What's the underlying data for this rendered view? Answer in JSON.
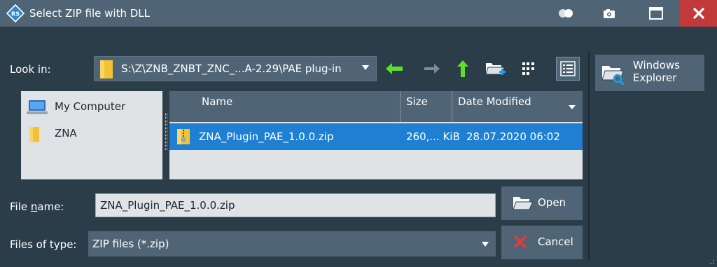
{
  "window": {
    "title": "Select ZIP file with DLL"
  },
  "lookin": {
    "label": "Look in:",
    "path": "S:\\Z\\ZNB_ZNBT_ZNC_...A-2.29\\PAE plug-in"
  },
  "sidebar": {
    "explorer_label": "Windows\nExplorer"
  },
  "places": {
    "items": [
      {
        "label": "My Computer",
        "icon": "computer-icon"
      },
      {
        "label": "ZNA",
        "icon": "folder-icon"
      }
    ]
  },
  "files": {
    "columns": [
      "Name",
      "Size",
      "Date Modified"
    ],
    "rows": [
      {
        "name": "ZNA_Plugin_PAE_1.0.0.zip",
        "size": "260,... KiB",
        "modified": "28.07.2020 06:02",
        "icon": "zip-file-icon",
        "selected": true
      }
    ]
  },
  "filename": {
    "label_pre": "File ",
    "label_u": "n",
    "label_post": "ame:",
    "value": "ZNA_Plugin_PAE_1.0.0.zip"
  },
  "filetype": {
    "label": "Files of type:",
    "value": "ZIP files (*.zip)"
  },
  "buttons": {
    "open": "Open",
    "cancel": "Cancel"
  },
  "colors": {
    "titlebar": "#4f6576",
    "background": "#2c3d4a",
    "selection": "#1e7fd3",
    "close": "#c03a3c",
    "arrow_green": "#5ee02a"
  }
}
